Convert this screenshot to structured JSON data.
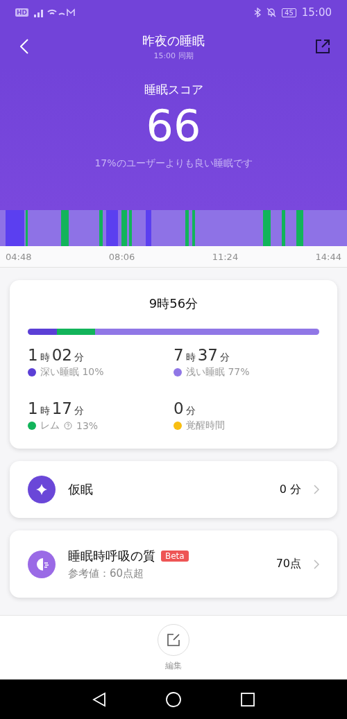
{
  "status_bar": {
    "left": "HD",
    "battery": "45",
    "time": "15:00"
  },
  "header": {
    "title": "昨夜の睡眠",
    "subtitle": "15:00 同期"
  },
  "score": {
    "label": "睡眠スコア",
    "value": "66",
    "note": "17%のユーザーよりも良い睡眠です"
  },
  "timeline": {
    "ticks": [
      "04:48",
      "08:06",
      "11:24",
      "14:44"
    ]
  },
  "summary": {
    "total": "9時56分",
    "stats": [
      {
        "kind": "deep",
        "hours": "1",
        "h_unit": "時",
        "minutes": "02",
        "m_unit": "分",
        "label": "深い睡眠 10%",
        "color": "#5b3fd6",
        "level": 0.1
      },
      {
        "kind": "light",
        "hours": "7",
        "h_unit": "時",
        "minutes": "37",
        "m_unit": "分",
        "label": "浅い睡眠 77%",
        "color": "#9077e6",
        "level": 0.77
      },
      {
        "kind": "rem",
        "hours": "1",
        "h_unit": "時",
        "minutes": "17",
        "m_unit": "分",
        "label": "レム",
        "label_extra": "13%",
        "color": "#12b45a",
        "level": 0.13
      },
      {
        "kind": "awake",
        "minutes": "0",
        "m_unit": "分",
        "label": "覚醒時間",
        "color": "#f8be12"
      }
    ]
  },
  "rows": [
    {
      "kind": "nap",
      "title": "仮眠",
      "value": "0 分"
    },
    {
      "kind": "breath",
      "title": "睡眠時呼吸の質",
      "badge": "Beta",
      "subtitle": "参考値：60点超",
      "value": "70点"
    }
  ],
  "footer": {
    "edit_label": "編集"
  }
}
